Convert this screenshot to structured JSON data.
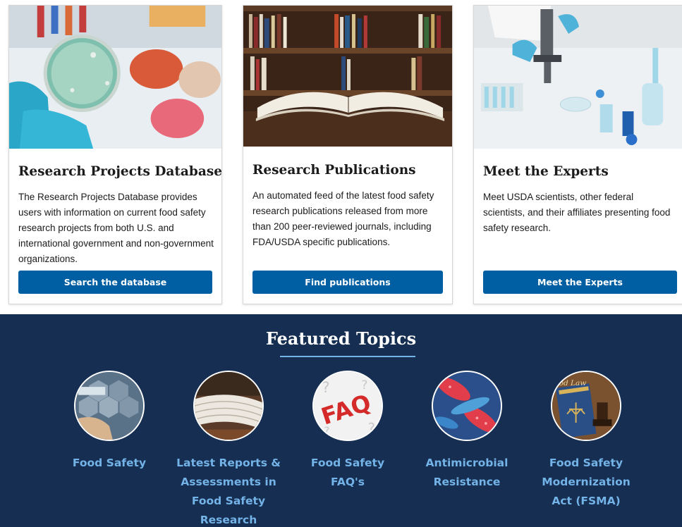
{
  "cards": [
    {
      "title": "Research Projects Database",
      "description": "The Research Projects Database provides users with information on current food safety research projects from both U.S. and international government and non-government organizations.",
      "button": "Search the database",
      "image_icon": "petri-dish-image"
    },
    {
      "title": "Research Publications",
      "description": "An automated feed of the latest food safety research publications released from more than 200 peer-reviewed journals, including FDA/USDA specific publications.",
      "button": "Find publications",
      "image_icon": "open-book-image"
    },
    {
      "title": "Meet the Experts",
      "description": "Meet USDA scientists, other federal scientists, and their affiliates presenting food safety research.",
      "button": "Meet the Experts",
      "image_icon": "laboratory-image"
    }
  ],
  "featured": {
    "title": "Featured Topics",
    "topics": [
      {
        "label": "Food Safety",
        "image_icon": "haccp-image"
      },
      {
        "label": "Latest Reports & Assessments in Food Safety Research",
        "image_icon": "reports-image"
      },
      {
        "label": "Food Safety FAQ's",
        "image_icon": "faq-image",
        "image_text": "FAQ"
      },
      {
        "label": "Antimicrobial Resistance",
        "image_icon": "bacteria-image"
      },
      {
        "label": "Food Safety Modernization Act (FSMA)",
        "image_icon": "law-book-image",
        "image_text": "od Law"
      }
    ]
  },
  "colors": {
    "button": "#005ea2",
    "featured_background": "#162e51",
    "topic_link": "#73b3e7",
    "underline": "#73b3e7"
  }
}
